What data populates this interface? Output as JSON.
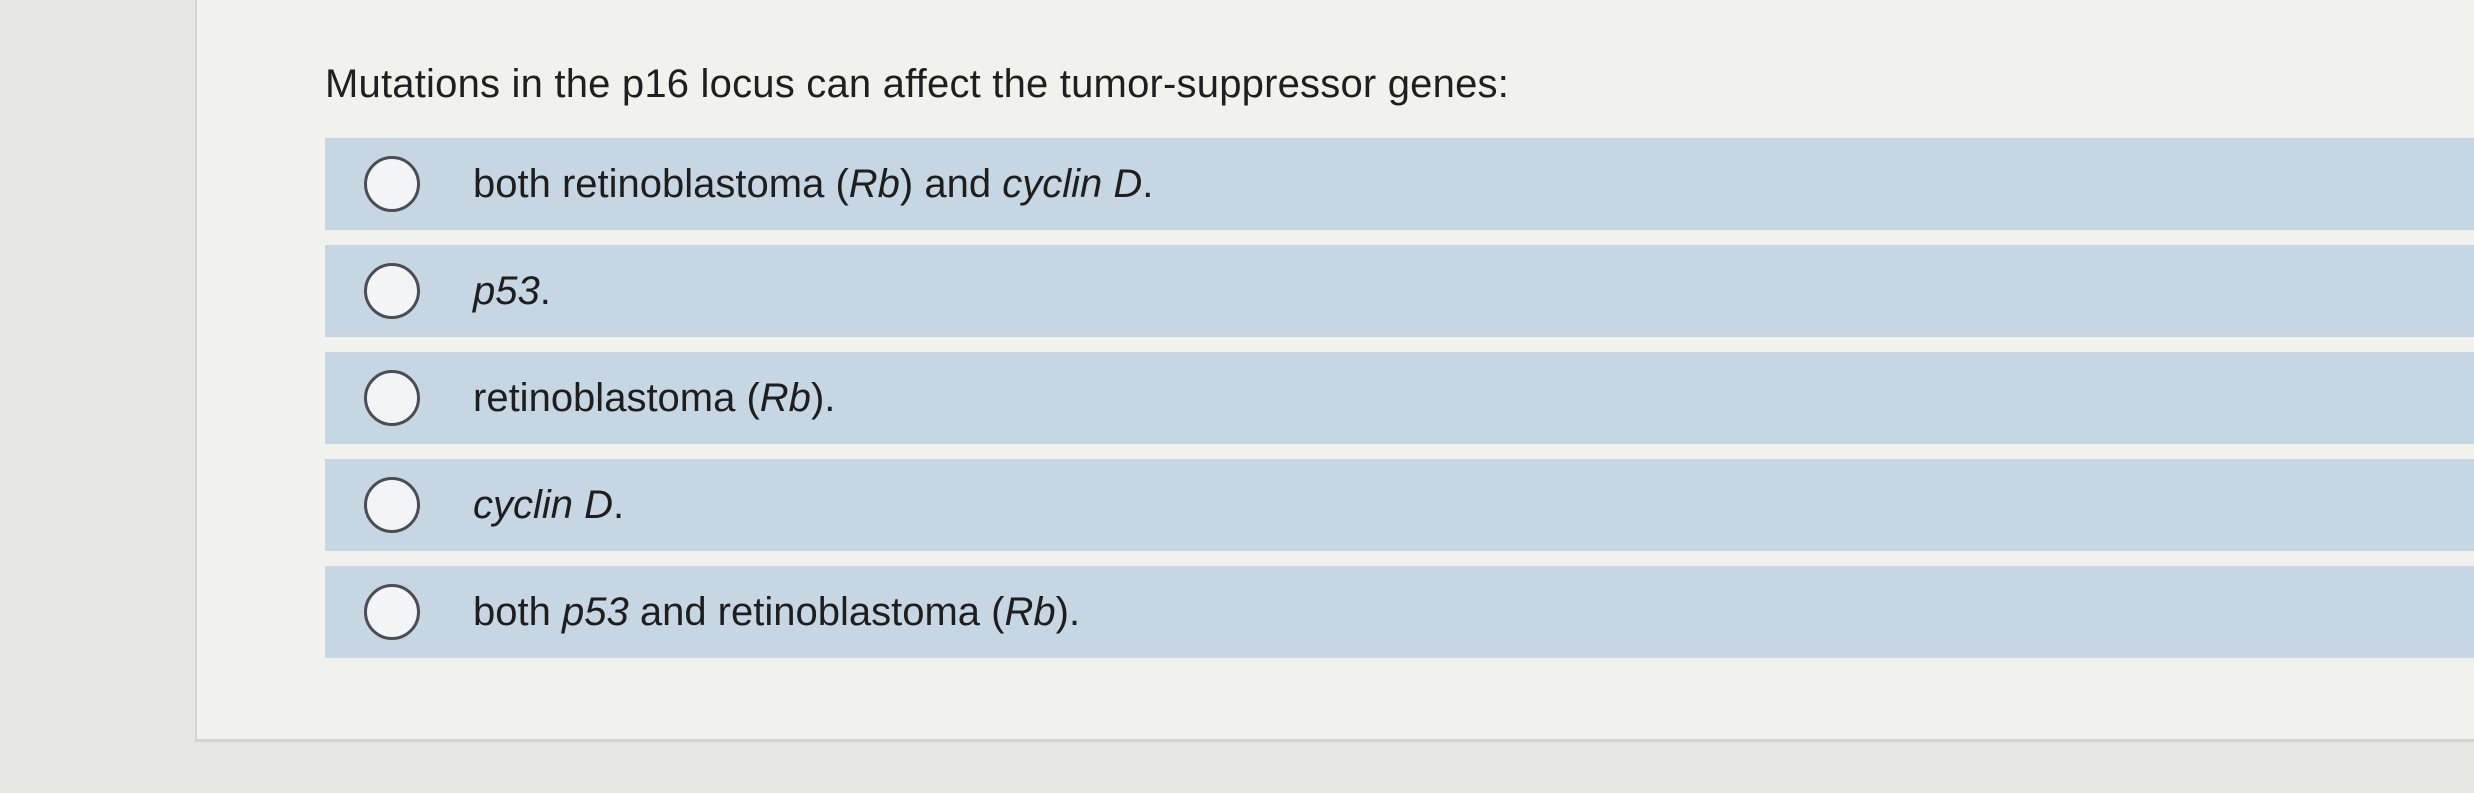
{
  "question": {
    "text": "Mutations in the p16 locus can affect the tumor-suppressor genes:"
  },
  "options": [
    {
      "parts": [
        {
          "t": "both retinoblastoma ("
        },
        {
          "t": "Rb",
          "i": true
        },
        {
          "t": ") and "
        },
        {
          "t": "cyclin D",
          "i": true
        },
        {
          "t": "."
        }
      ],
      "selected": false
    },
    {
      "parts": [
        {
          "t": "p53",
          "i": true
        },
        {
          "t": "."
        }
      ],
      "selected": false
    },
    {
      "parts": [
        {
          "t": "retinoblastoma ("
        },
        {
          "t": "Rb",
          "i": true
        },
        {
          "t": ")."
        }
      ],
      "selected": false
    },
    {
      "parts": [
        {
          "t": "cyclin D",
          "i": true
        },
        {
          "t": "."
        }
      ],
      "selected": false
    },
    {
      "parts": [
        {
          "t": "both "
        },
        {
          "t": "p53",
          "i": true
        },
        {
          "t": " and retinoblastoma ("
        },
        {
          "t": "Rb",
          "i": true
        },
        {
          "t": ")."
        }
      ],
      "selected": false
    }
  ],
  "colors": {
    "option_background": "#c6d6e3",
    "page_background": "#e6e6e3",
    "card_background": "#f1f1ee"
  }
}
